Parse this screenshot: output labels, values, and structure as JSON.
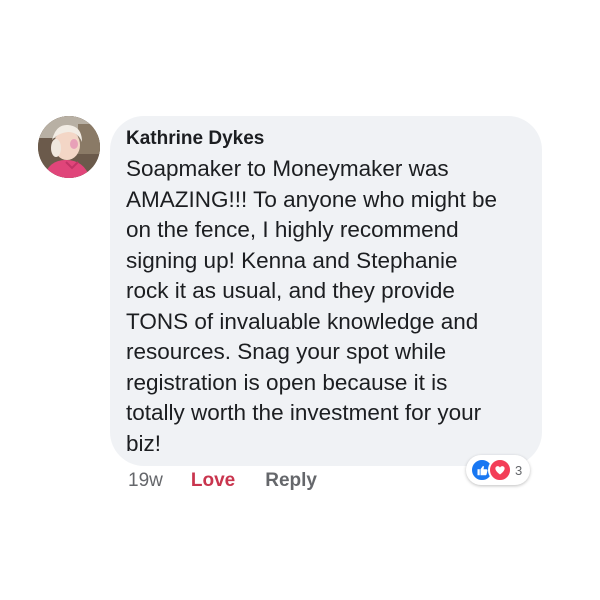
{
  "comment": {
    "author": "Kathrine Dykes",
    "text_lines": [
      "Soapmaker to Moneymaker was",
      "AMAZING!!! To anyone who might be",
      "on the fence, I highly recommend",
      "signing up! Kenna and Stephanie",
      "rock it as usual, and they provide",
      "TONS of invaluable knowledge and",
      "resources. Snag your spot while",
      "registration is open because it is",
      "totally worth the investment for your",
      "biz!"
    ],
    "timestamp": "19w",
    "love_label": "Love",
    "reply_label": "Reply",
    "reaction_count": "3",
    "reaction_icons": [
      "like-icon",
      "love-icon"
    ]
  },
  "colors": {
    "bubble_bg": "#f0f2f5",
    "text": "#1c1e21",
    "meta": "#65676b",
    "love": "#c9354e",
    "like_blue": "#1877f2",
    "love_red": "#f33e58"
  }
}
